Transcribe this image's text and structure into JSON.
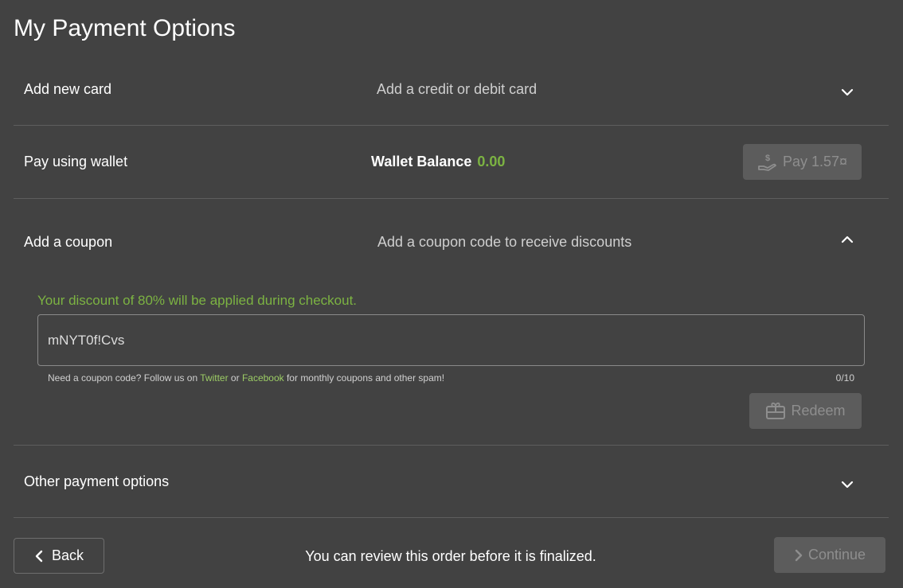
{
  "page": {
    "title": "My Payment Options"
  },
  "sections": {
    "add_card": {
      "title": "Add new card",
      "description": "Add a credit or debit card",
      "expanded": false
    },
    "wallet": {
      "title": "Pay using wallet",
      "balance_label": "Wallet Balance",
      "balance_value": "0.00",
      "pay_button_label": "Pay 1.57¤",
      "pay_button_icon": "hand-coin-icon"
    },
    "coupon": {
      "title": "Add a coupon",
      "description": "Add a coupon code to receive discounts",
      "expanded": true,
      "discount_message": "Your discount of 80% will be applied during checkout.",
      "input_value": "mNYT0f!Cvs",
      "hint_prefix": "Need a coupon code? Follow us on ",
      "hint_link_twitter": "Twitter",
      "hint_or": " or ",
      "hint_link_facebook": "Facebook",
      "hint_suffix": " for monthly coupons and other spam!",
      "counter": "0/10",
      "redeem_label": "Redeem",
      "redeem_icon": "gift-card-icon"
    },
    "other": {
      "title": "Other payment options",
      "expanded": false
    }
  },
  "footer": {
    "back_label": "Back",
    "note": "You can review this order before it is finalized.",
    "continue_label": "Continue"
  },
  "colors": {
    "background": "#424242",
    "accent_green": "#7cb342",
    "link_green": "#9ccc65",
    "disabled_button": "#5c5c5c"
  }
}
